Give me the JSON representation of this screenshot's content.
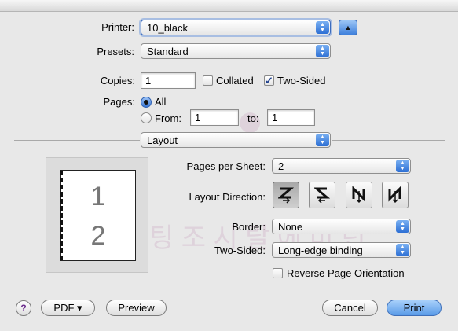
{
  "printer": {
    "label": "Printer:",
    "value": "10_black"
  },
  "presets": {
    "label": "Presets:",
    "value": "Standard"
  },
  "copies": {
    "label": "Copies:",
    "value": "1",
    "collated_label": "Collated",
    "collated": false,
    "two_sided_label": "Two-Sided",
    "two_sided": true
  },
  "pages": {
    "label": "Pages:",
    "all_label": "All",
    "from_label": "From:",
    "from_value": "1",
    "to_label": "to:",
    "to_value": "1",
    "selected": "all"
  },
  "panel": {
    "value": "Layout"
  },
  "layout": {
    "pages_per_sheet_label": "Pages per Sheet:",
    "pages_per_sheet_value": "2",
    "direction_label": "Layout Direction:",
    "directions": [
      "left-to-right-then-down-icon",
      "right-to-left-then-down-icon",
      "top-to-bottom-then-right-icon",
      "top-to-bottom-then-left-icon"
    ],
    "selected_direction": 0,
    "border_label": "Border:",
    "border_value": "None",
    "two_sided_label": "Two-Sided:",
    "two_sided_value": "Long-edge binding",
    "reverse_label": "Reverse Page Orientation",
    "reverse": false
  },
  "preview": {
    "page1": "1",
    "page2": "2"
  },
  "buttons": {
    "help": "?",
    "pdf": "PDF ▾",
    "preview": "Preview",
    "cancel": "Cancel",
    "print": "Print"
  },
  "colors": {
    "accent": "#3f80dc",
    "window_bg": "#e8e8e8"
  }
}
